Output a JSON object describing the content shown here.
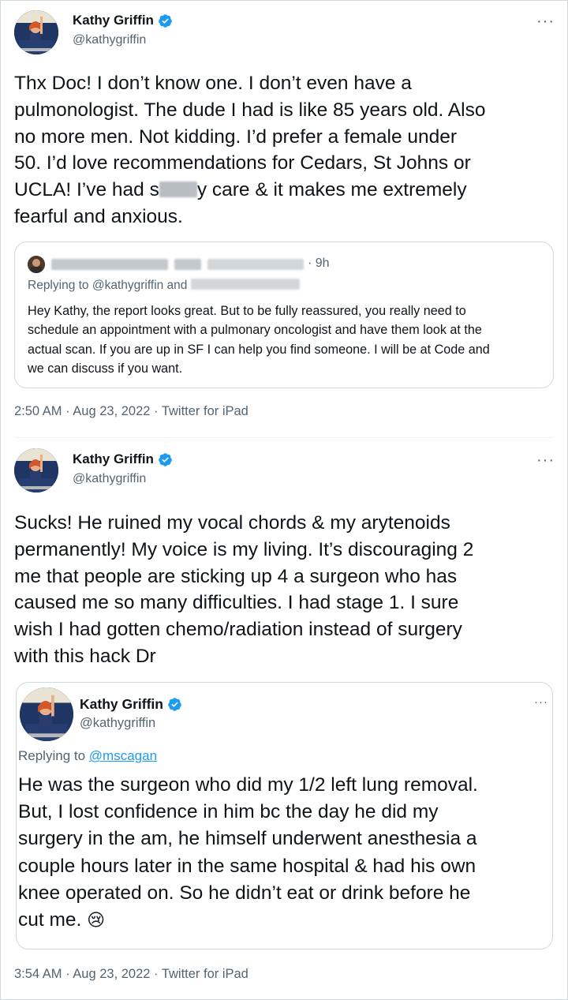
{
  "tweet1": {
    "author_name": "Kathy Griffin",
    "author_handle": "@kathygriffin",
    "more_label": "···",
    "text_lines": [
      "Thx Doc! I don’t know one. I don’t even have a",
      "pulmonologist. The dude I had is like 85 years old. Also",
      "no more men. Not kidding. I’d prefer a female under",
      "50. I’d love recommendations for Cedars, St Johns or",
      "UCLA! I’ve had s",
      "y care & it makes me extremely",
      "fearful and anxious."
    ],
    "quote": {
      "time": "· 9h",
      "replying_prefix": "Replying to @kathygriffin and",
      "text_lines": [
        "Hey Kathy, the report looks great. But to be fully reassured, you really need to",
        "schedule an appointment with a pulmonary oncologist and have them look at the",
        "actual scan. If you are up in SF I can help you find someone. I will be at Code and",
        "we can discuss if you want."
      ]
    },
    "meta": "2:50 AM · Aug 23, 2022 · Twitter for iPad"
  },
  "tweet2": {
    "author_name": "Kathy Griffin",
    "author_handle": "@kathygriffin",
    "more_label": "···",
    "text_lines": [
      "Sucks! He ruined my vocal chords & my arytenoids",
      "permanently! My voice is my living. It’s discouraging 2",
      "me that people are sticking up 4 a surgeon who has",
      "caused me so many difficulties. I had stage 1. I sure",
      "wish I had gotten chemo/radiation instead of surgery",
      "with this hack Dr"
    ],
    "quote": {
      "author_name": "Kathy Griffin",
      "author_handle": "@kathygriffin",
      "more_label": "···",
      "replying_prefix": "Replying to",
      "replying_handle": "@mscagan",
      "text_lines": [
        "He was the surgeon who did my 1/2 left lung removal.",
        "But, I lost confidence in him bc the day he did my",
        "surgery in the am, he himself underwent anesthesia a",
        "couple hours later in the same hospital & had his own",
        "knee operated on. So he didn’t eat or drink before he",
        "cut me."
      ],
      "emoji": "😢"
    },
    "meta": "3:54 AM · Aug 23, 2022 · Twitter for iPad"
  },
  "colors": {
    "text": "#0f1419",
    "muted": "#536471",
    "verified": "#1d9bf0",
    "border": "#cfd9de"
  },
  "icons": {
    "verified": "verified-badge-icon",
    "more": "more-horizontal-icon"
  }
}
